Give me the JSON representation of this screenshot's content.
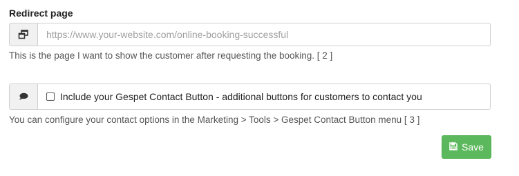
{
  "redirect": {
    "title": "Redirect page",
    "url_value": "",
    "url_placeholder": "https://www.your-website.com/online-booking-successful",
    "help_text": "This is the page I want to show the customer after requesting the booking. [ 2 ]",
    "icon": "external-window-icon"
  },
  "contact_button": {
    "checkbox_label": "Include your Gespet Contact Button - additional buttons for customers to contact you",
    "checked": false,
    "help_text": "You can configure your contact options in the Marketing > Tools > Gespet Contact Button menu [ 3 ]",
    "icon": "speech-bubble-icon"
  },
  "save_button": {
    "label": "Save",
    "icon": "floppy-disk-icon",
    "color": "#5cb85c"
  }
}
